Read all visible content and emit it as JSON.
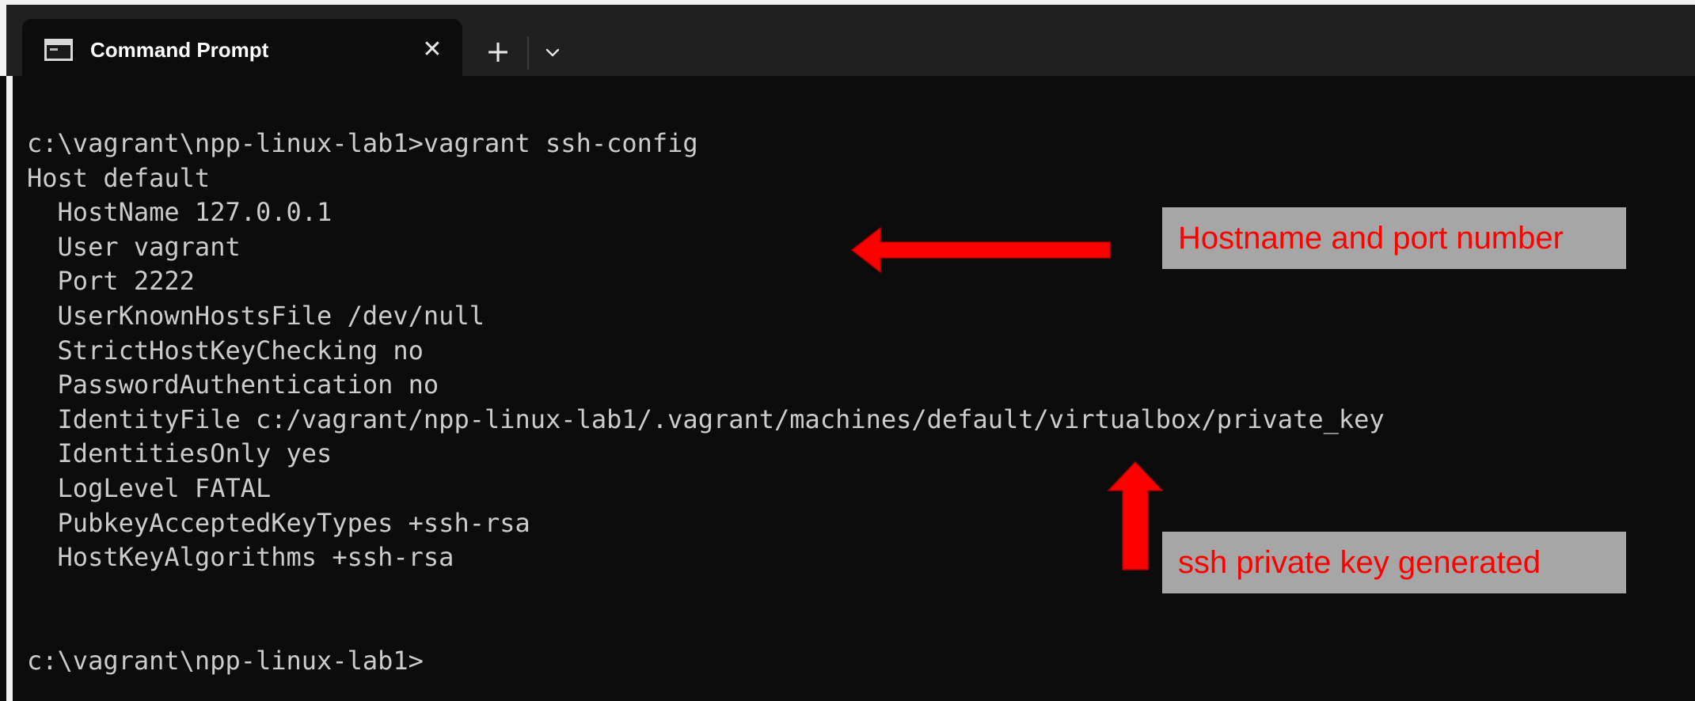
{
  "window": {
    "tab": {
      "title": "Command Prompt",
      "close_glyph": "✕",
      "icon": "console-icon"
    },
    "new_tab_glyph": "+",
    "dropdown_icon": "chevron-down-icon"
  },
  "terminal": {
    "lines": [
      "c:\\vagrant\\npp-linux-lab1>vagrant ssh-config",
      "Host default",
      "  HostName 127.0.0.1",
      "  User vagrant",
      "  Port 2222",
      "  UserKnownHostsFile /dev/null",
      "  StrictHostKeyChecking no",
      "  PasswordAuthentication no",
      "  IdentityFile c:/vagrant/npp-linux-lab1/.vagrant/machines/default/virtualbox/private_key",
      "  IdentitiesOnly yes",
      "  LogLevel FATAL",
      "  PubkeyAcceptedKeyTypes +ssh-rsa",
      "  HostKeyAlgorithms +ssh-rsa",
      "",
      "",
      "c:\\vagrant\\npp-linux-lab1>"
    ]
  },
  "annotations": {
    "hostname_label": "Hostname and port number",
    "key_label": "ssh private key generated",
    "arrow_color": "#ff0000",
    "callout_background": "#a6a6a6"
  }
}
